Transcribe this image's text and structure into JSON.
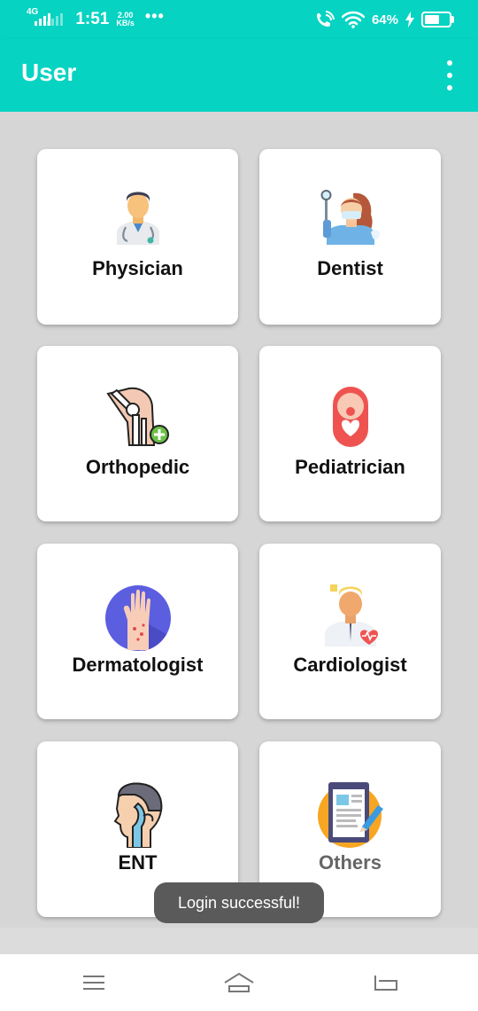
{
  "status_bar": {
    "network": "4G",
    "time": "1:51",
    "speed_value": "2.00",
    "speed_unit": "KB/s",
    "more": "•••",
    "battery_percent": "64%"
  },
  "app_bar": {
    "title": "User",
    "overflow_icon": "more-vert-icon"
  },
  "categories": [
    {
      "label": "Physician",
      "icon": "physician-icon"
    },
    {
      "label": "Dentist",
      "icon": "dentist-icon"
    },
    {
      "label": "Orthopedic",
      "icon": "orthopedic-icon"
    },
    {
      "label": "Pediatrician",
      "icon": "pediatrician-icon"
    },
    {
      "label": "Dermatologist",
      "icon": "dermatologist-icon"
    },
    {
      "label": "Cardiologist",
      "icon": "cardiologist-icon"
    },
    {
      "label": "ENT",
      "icon": "ent-icon"
    },
    {
      "label": "Others",
      "icon": "others-icon"
    }
  ],
  "toast": {
    "message": "Login successful!"
  },
  "bottom_nav": {
    "menu_icon": "menu-icon",
    "home_icon": "home-icon",
    "back_icon": "back-icon"
  },
  "colors": {
    "primary": "#07d3c2",
    "background": "#d6d6d6",
    "card": "#ffffff",
    "toast": "#5a5a5a"
  }
}
